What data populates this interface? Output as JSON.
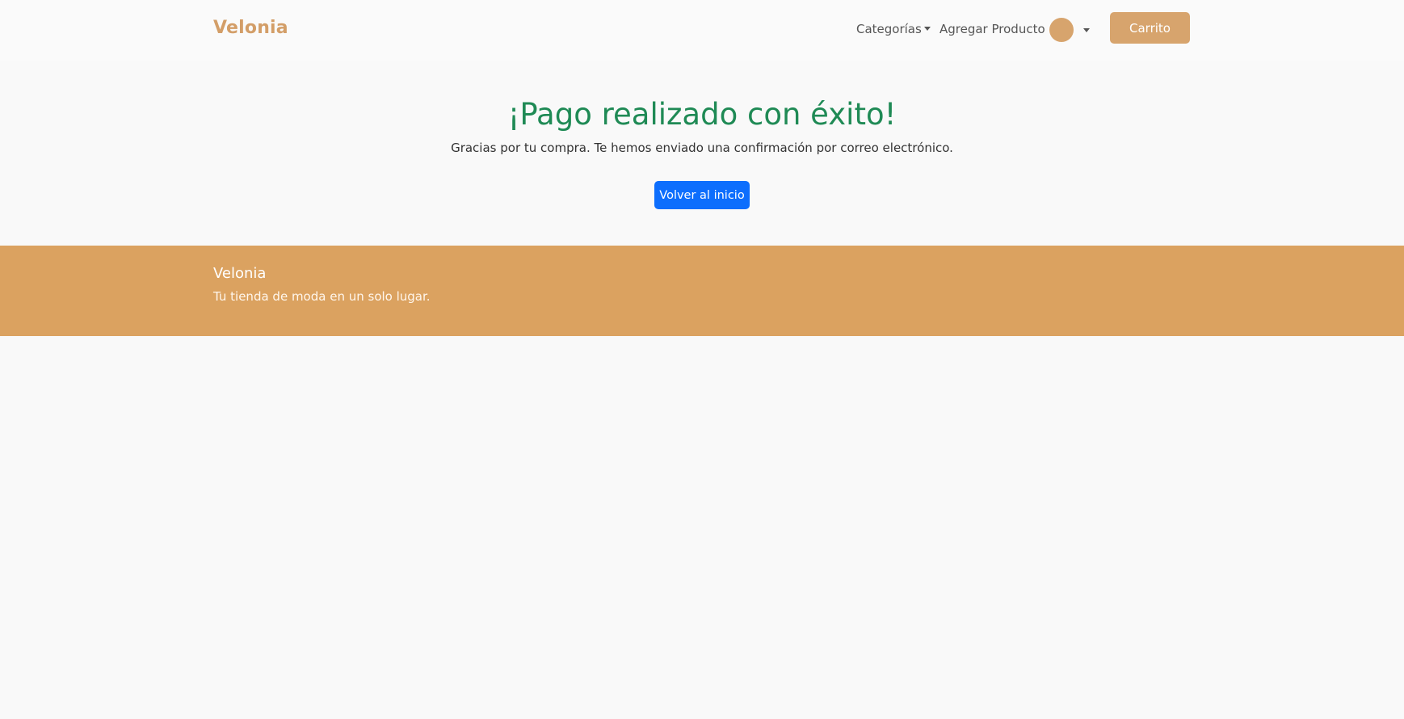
{
  "navbar": {
    "brand": "Velonia",
    "categorias_label": "Categorías",
    "agregar_label": "Agregar Producto",
    "cart_label": "Carrito"
  },
  "hero": {
    "title": "¡Pago realizado con éxito!",
    "message": "Gracias por tu compra. Te hemos enviado una confirmación por correo electrónico.",
    "button_label": "Volver al inicio"
  },
  "footer": {
    "brand": "Velonia",
    "tagline": "Tu tienda de moda en un solo lugar."
  },
  "colors": {
    "brand": "#d39e68",
    "accent": "#d7a46d",
    "footer_bg": "#dba260",
    "success": "#1f8a55",
    "primary_button": "#0d6efd"
  },
  "icons": {
    "user": "user-avatar-icon",
    "dropdown": "caret-down-icon"
  }
}
